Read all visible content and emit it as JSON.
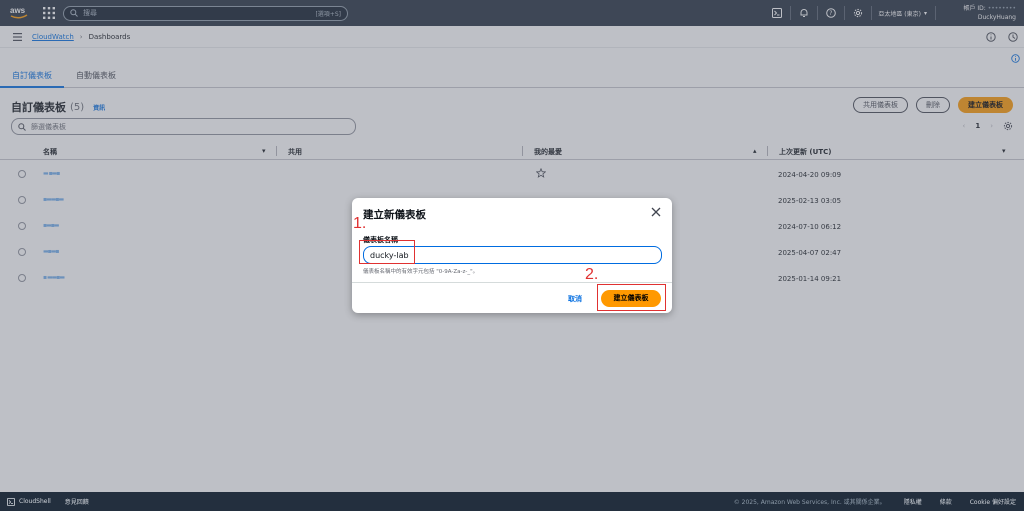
{
  "topbar": {
    "search_placeholder": "搜尋",
    "search_shortcut": "[選項+S]",
    "region": "亞太地區 (東京)",
    "account_id_label": "帳戶 ID:",
    "account_user": "DuckyHuang"
  },
  "breadcrumb": {
    "service": "CloudWatch",
    "current": "Dashboards"
  },
  "tabs": [
    {
      "label": "自訂儀表板",
      "active": true
    },
    {
      "label": "自動儀表板",
      "active": false
    }
  ],
  "page": {
    "title": "自訂儀表板",
    "count": "(5)",
    "info": "資訊",
    "buttons": {
      "share": "共用儀表板",
      "delete": "刪除",
      "create": "建立儀表板"
    },
    "filter_placeholder": "篩選儀表板",
    "page_number": "1"
  },
  "table": {
    "columns": [
      "名稱",
      "共用",
      "我的最愛",
      "上次更新 (UTC)"
    ],
    "rows": [
      {
        "date": "2024-04-20 09:09"
      },
      {
        "date": "2025-02-13 03:05"
      },
      {
        "date": "2024-07-10 06:12"
      },
      {
        "date": "2025-04-07 02:47"
      },
      {
        "date": "2025-01-14 09:21"
      }
    ]
  },
  "modal": {
    "title": "建立新儀表板",
    "field_label": "儀表板名稱",
    "field_value": "ducky-lab",
    "hint": "儀表板名稱中的有效字元包括 \"0-9A-Za-z-_\"。",
    "cancel": "取消",
    "create": "建立儀表板"
  },
  "annotations": {
    "step1": "1.",
    "step2": "2.",
    "color": "#e03131"
  },
  "footer": {
    "cloudshell": "CloudShell",
    "feedback": "意見回饋",
    "copyright": "© 2025, Amazon Web Services, Inc. 或其關係企業。",
    "privacy": "隱私權",
    "terms": "條款",
    "cookies": "Cookie 偏好設定"
  },
  "colors": {
    "nav_bg": "#232f3e",
    "primary": "#ff9900",
    "link": "#006ce0"
  }
}
